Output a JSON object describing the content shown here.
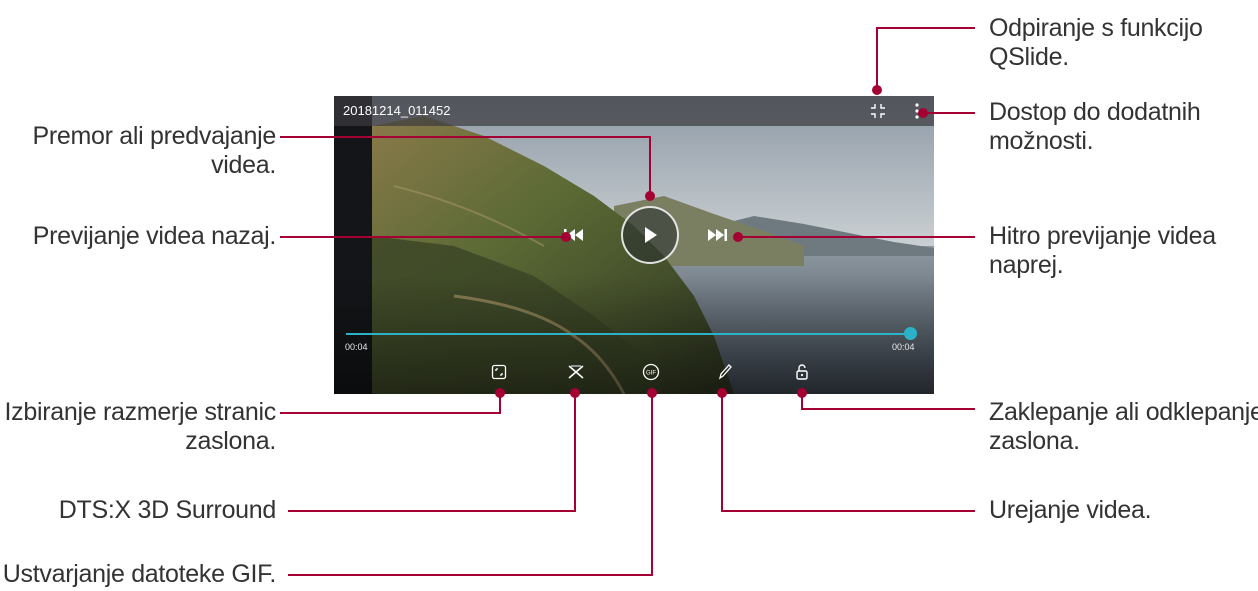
{
  "video": {
    "file_title": "20181214_011452",
    "time_elapsed": "00:04",
    "time_total": "00:04",
    "progress_fraction": 0.99,
    "accent_color": "#2bb2c8",
    "icons": {
      "qslide": "qslide-icon",
      "more": "more-options-icon",
      "rewind": "rewind-icon",
      "play": "play-icon",
      "fast_forward": "fast-forward-icon",
      "aspect_ratio": "aspect-ratio-icon",
      "dts_surround": "dts-x-icon",
      "gif": "gif-icon",
      "edit": "pencil-icon",
      "lock": "lock-icon"
    }
  },
  "callouts": {
    "qslide_line1": "Odpiranje s funkcijo",
    "qslide_line2": "QSlide.",
    "more_line1": "Dostop do dodatnih",
    "more_line2": "možnosti.",
    "pause_line1": "Premor ali predvajanje",
    "pause_line2": "videa.",
    "rewind": "Previjanje videa nazaj.",
    "forward_line1": "Hitro previjanje videa",
    "forward_line2": "naprej.",
    "aspect_line1": "Izbiranje razmerje stranic",
    "aspect_line2": "zaslona.",
    "lock_line1": "Zaklepanje ali odklepanje",
    "lock_line2": "zaslona.",
    "dts": "DTS:X 3D Surround",
    "edit": "Urejanje videa.",
    "gif": "Ustvarjanje datoteke GIF."
  },
  "leader_color": "#a50034"
}
